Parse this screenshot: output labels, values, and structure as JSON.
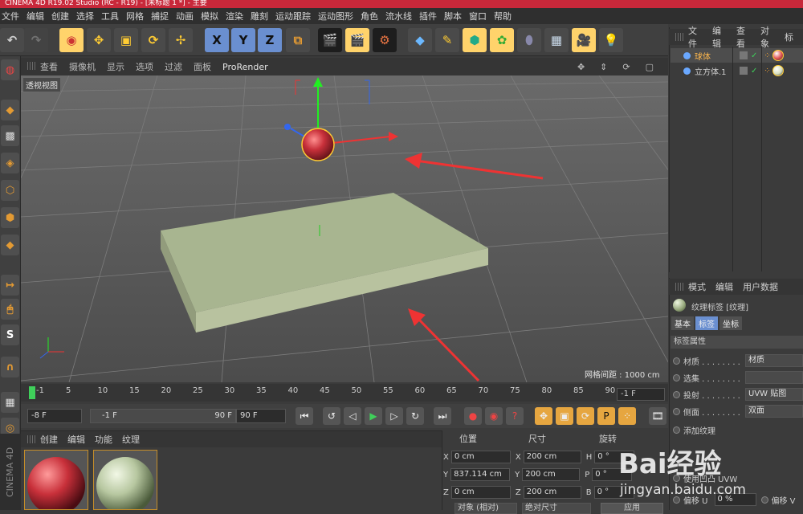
{
  "window": {
    "title": "CINEMA 4D R19.02 Studio (RC - R19) - [未标题 1 *] - 主要"
  },
  "menu": [
    "文件",
    "编辑",
    "创建",
    "选择",
    "工具",
    "网格",
    "捕捉",
    "动画",
    "模拟",
    "渲染",
    "雕刻",
    "运动跟踪",
    "运动图形",
    "角色",
    "流水线",
    "插件",
    "脚本",
    "窗口",
    "帮助"
  ],
  "toolbar": {
    "axis_x": "X",
    "axis_y": "Y",
    "axis_z": "Z"
  },
  "viewport": {
    "menu": [
      "查看",
      "摄像机",
      "显示",
      "选项",
      "过滤",
      "面板",
      "ProRender"
    ],
    "title": "透视视图",
    "grid_info": "网格间距 : 1000 cm"
  },
  "timeline": {
    "ticks": [
      "-1",
      "5",
      "10",
      "15",
      "20",
      "25",
      "30",
      "35",
      "40",
      "45",
      "50",
      "55",
      "60",
      "65",
      "70",
      "75",
      "80",
      "85",
      "90"
    ],
    "current": "-1 F",
    "start": "-8 F",
    "range_start": "-1 F",
    "range_end": "90 F",
    "end": "90 F"
  },
  "material_manager": {
    "menu": [
      "创建",
      "编辑",
      "功能",
      "纹理"
    ],
    "logo": "CINEMA 4D"
  },
  "coordinates": {
    "headers": [
      "位置",
      "尺寸",
      "旋转"
    ],
    "rows": [
      {
        "axis": "X",
        "pos": "0 cm",
        "size_axis": "X",
        "size": "200 cm",
        "rot_axis": "H",
        "rot": "0 °"
      },
      {
        "axis": "Y",
        "pos": "837.114 cm",
        "size_axis": "Y",
        "size": "200 cm",
        "rot_axis": "P",
        "rot": "0 °"
      },
      {
        "axis": "Z",
        "pos": "0 cm",
        "size_axis": "Z",
        "size": "200 cm",
        "rot_axis": "B",
        "rot": "0 °"
      }
    ],
    "mode": "对象 (相对)",
    "size_mode": "绝对尺寸",
    "apply": "应用"
  },
  "objects": {
    "menu": [
      "文件",
      "编辑",
      "查看",
      "对象",
      "标"
    ],
    "items": [
      {
        "name": "球体",
        "selected": true,
        "color": "#e05050"
      },
      {
        "name": "立方体.1",
        "selected": false,
        "color": "#d8e0c0"
      }
    ]
  },
  "attributes": {
    "menu": [
      "模式",
      "编辑",
      "用户数据"
    ],
    "title": "纹理标签 [纹理]",
    "tabs": [
      "基本",
      "标签",
      "坐标"
    ],
    "section": "标签属性",
    "rows": [
      {
        "label": "材质 . . . . . . . .",
        "value": "材质"
      },
      {
        "label": "选集 . . . . . . . .",
        "value": ""
      },
      {
        "label": "投射 . . . . . . . .",
        "value": "UVW 贴图"
      },
      {
        "label": "侧面 . . . . . . . .",
        "value": "双面"
      }
    ],
    "extra": [
      "添加纹理",
      "使用凹凸 UVW",
      "偏移 U",
      "0 %",
      "偏移 V"
    ]
  },
  "watermark": {
    "brand": "Bai经验",
    "url": "jingyan.baidu.com"
  },
  "colors": {
    "accent": "#ffd36b",
    "sphere": "#c8303a",
    "plane": "#a8b590",
    "arrow": "#ee3333"
  }
}
